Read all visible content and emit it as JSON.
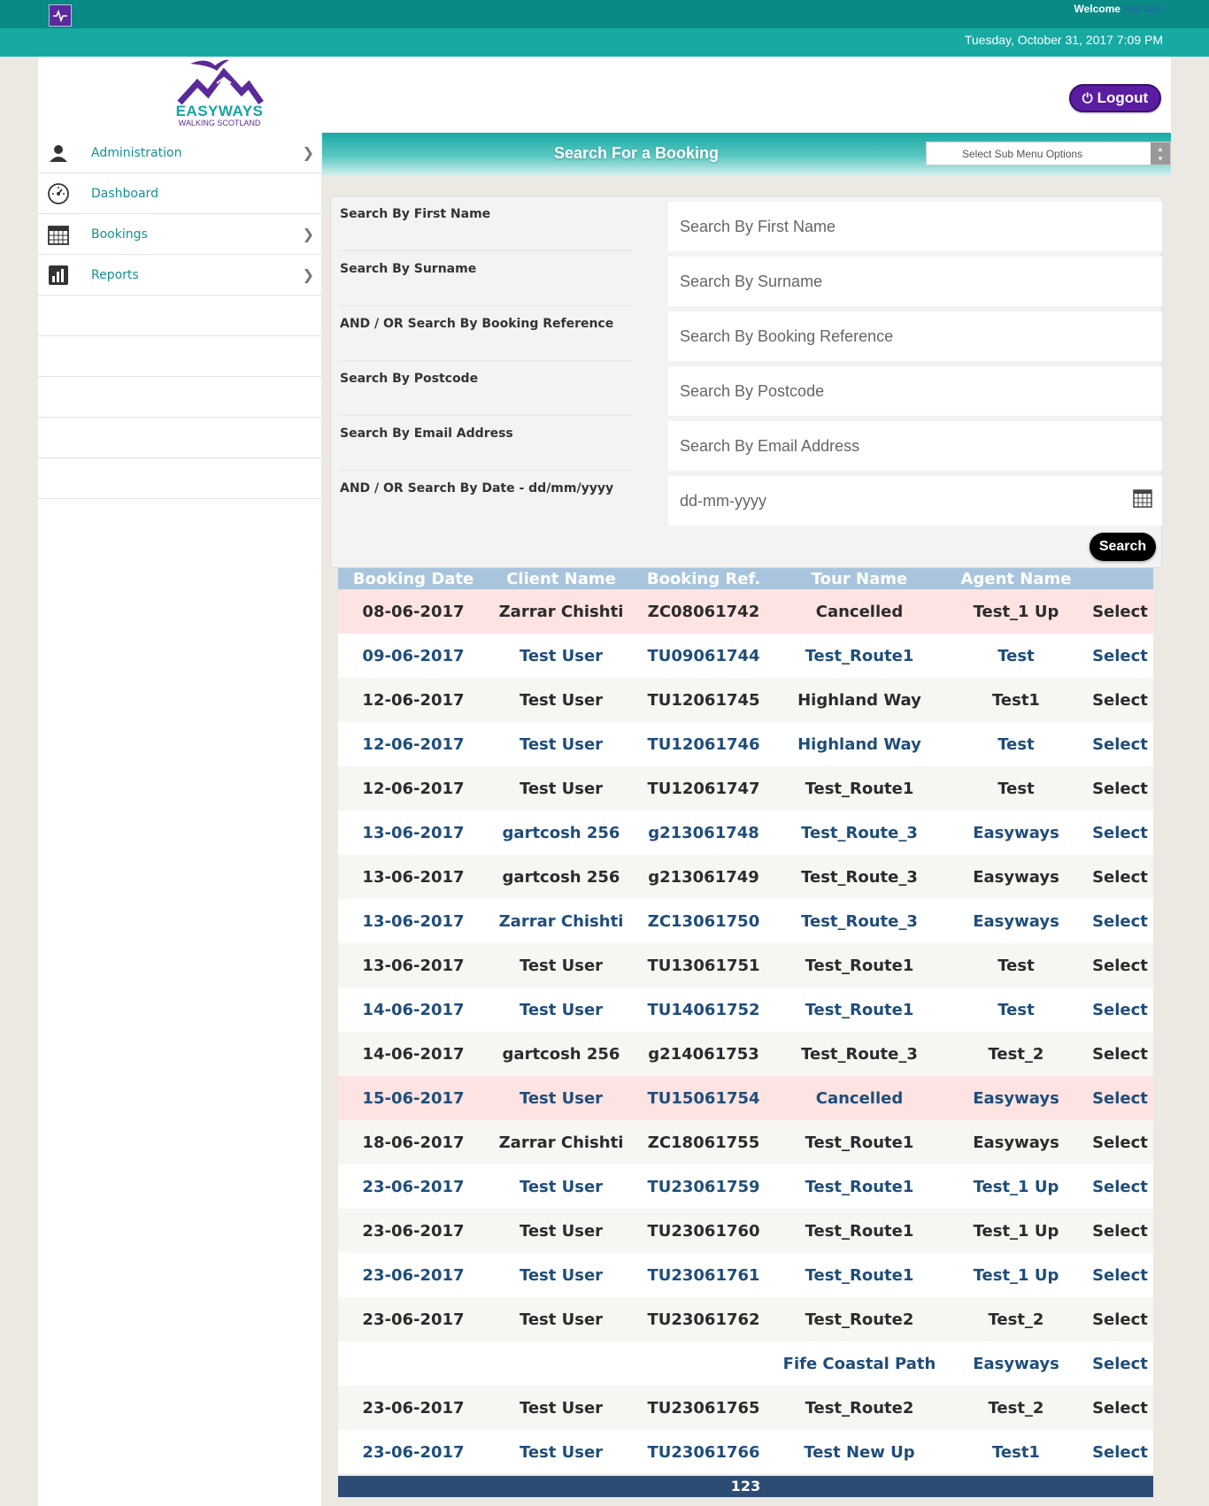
{
  "topbar": {
    "welcome_label": "Welcome",
    "welcome_user": "test test",
    "datetime": "Tuesday, October 31, 2017 7:09 PM"
  },
  "header": {
    "logo_text": "EASYWAYS",
    "logo_subtext": "WALKING SCOTLAND",
    "logout_label": "Logout"
  },
  "sidebar": {
    "items": [
      {
        "label": "Administration",
        "icon": "user-icon",
        "has_submenu": true
      },
      {
        "label": "Dashboard",
        "icon": "dashboard-icon",
        "has_submenu": false
      },
      {
        "label": "Bookings",
        "icon": "calendar-icon",
        "has_submenu": true
      },
      {
        "label": "Reports",
        "icon": "bar-chart-icon",
        "has_submenu": true
      }
    ]
  },
  "panel": {
    "title": "Search For a Booking",
    "submenu_placeholder": "Select Sub Menu Options"
  },
  "search_form": {
    "fields": [
      {
        "label": "Search By First Name",
        "placeholder": "Search By First Name"
      },
      {
        "label": "Search By Surname",
        "placeholder": "Search By Surname"
      },
      {
        "label": "AND / OR Search By Booking Reference",
        "placeholder": "Search By Booking Reference"
      },
      {
        "label": "Search By Postcode",
        "placeholder": "Search By Postcode"
      },
      {
        "label": "Search By Email Address",
        "placeholder": "Search By Email Address"
      },
      {
        "label": "AND / OR Search By Date - dd/mm/yyyy",
        "placeholder": "dd-mm-yyyy"
      }
    ],
    "search_label": "Search"
  },
  "results": {
    "columns": [
      "Booking Date",
      "Client Name",
      "Booking Ref.",
      "Tour Name",
      "Agent Name",
      ""
    ],
    "rows": [
      {
        "date": "08-06-2017",
        "client": "Zarrar Chishti",
        "ref": "ZC08061742",
        "tour": "Cancelled",
        "agent": "Test_1 Up",
        "action": "Select",
        "cancelled": true
      },
      {
        "date": "09-06-2017",
        "client": "Test User",
        "ref": "TU09061744",
        "tour": "Test_Route1",
        "agent": "Test",
        "action": "Select"
      },
      {
        "date": "12-06-2017",
        "client": "Test User",
        "ref": "TU12061745",
        "tour": "Highland Way",
        "agent": "Test1",
        "action": "Select"
      },
      {
        "date": "12-06-2017",
        "client": "Test User",
        "ref": "TU12061746",
        "tour": "Highland Way",
        "agent": "Test",
        "action": "Select"
      },
      {
        "date": "12-06-2017",
        "client": "Test User",
        "ref": "TU12061747",
        "tour": "Test_Route1",
        "agent": "Test",
        "action": "Select"
      },
      {
        "date": "13-06-2017",
        "client": "gartcosh 256",
        "ref": "g213061748",
        "tour": "Test_Route_3",
        "agent": "Easyways",
        "action": "Select"
      },
      {
        "date": "13-06-2017",
        "client": "gartcosh 256",
        "ref": "g213061749",
        "tour": "Test_Route_3",
        "agent": "Easyways",
        "action": "Select"
      },
      {
        "date": "13-06-2017",
        "client": "Zarrar Chishti",
        "ref": "ZC13061750",
        "tour": "Test_Route_3",
        "agent": "Easyways",
        "action": "Select"
      },
      {
        "date": "13-06-2017",
        "client": "Test User",
        "ref": "TU13061751",
        "tour": "Test_Route1",
        "agent": "Test",
        "action": "Select"
      },
      {
        "date": "14-06-2017",
        "client": "Test User",
        "ref": "TU14061752",
        "tour": "Test_Route1",
        "agent": "Test",
        "action": "Select"
      },
      {
        "date": "14-06-2017",
        "client": "gartcosh 256",
        "ref": "g214061753",
        "tour": "Test_Route_3",
        "agent": "Test_2",
        "action": "Select"
      },
      {
        "date": "15-06-2017",
        "client": "Test User",
        "ref": "TU15061754",
        "tour": "Cancelled",
        "agent": "Easyways",
        "action": "Select",
        "cancelled": true
      },
      {
        "date": "18-06-2017",
        "client": "Zarrar Chishti",
        "ref": "ZC18061755",
        "tour": "Test_Route1",
        "agent": "Easyways",
        "action": "Select"
      },
      {
        "date": "23-06-2017",
        "client": "Test User",
        "ref": "TU23061759",
        "tour": "Test_Route1",
        "agent": "Test_1 Up",
        "action": "Select"
      },
      {
        "date": "23-06-2017",
        "client": "Test User",
        "ref": "TU23061760",
        "tour": "Test_Route1",
        "agent": "Test_1 Up",
        "action": "Select"
      },
      {
        "date": "23-06-2017",
        "client": "Test User",
        "ref": "TU23061761",
        "tour": "Test_Route1",
        "agent": "Test_1 Up",
        "action": "Select"
      },
      {
        "date": "23-06-2017",
        "client": "Test User",
        "ref": "TU23061762",
        "tour": "Test_Route2",
        "agent": "Test_2",
        "action": "Select"
      },
      {
        "date": "",
        "client": "",
        "ref": "",
        "tour": "Fife Coastal Path",
        "agent": "Easyways",
        "action": "Select"
      },
      {
        "date": "23-06-2017",
        "client": "Test User",
        "ref": "TU23061765",
        "tour": "Test_Route2",
        "agent": "Test_2",
        "action": "Select"
      },
      {
        "date": "23-06-2017",
        "client": "Test User",
        "ref": "TU23061766",
        "tour": "Test New Up",
        "agent": "Test1",
        "action": "Select"
      }
    ],
    "pagination": "123"
  }
}
